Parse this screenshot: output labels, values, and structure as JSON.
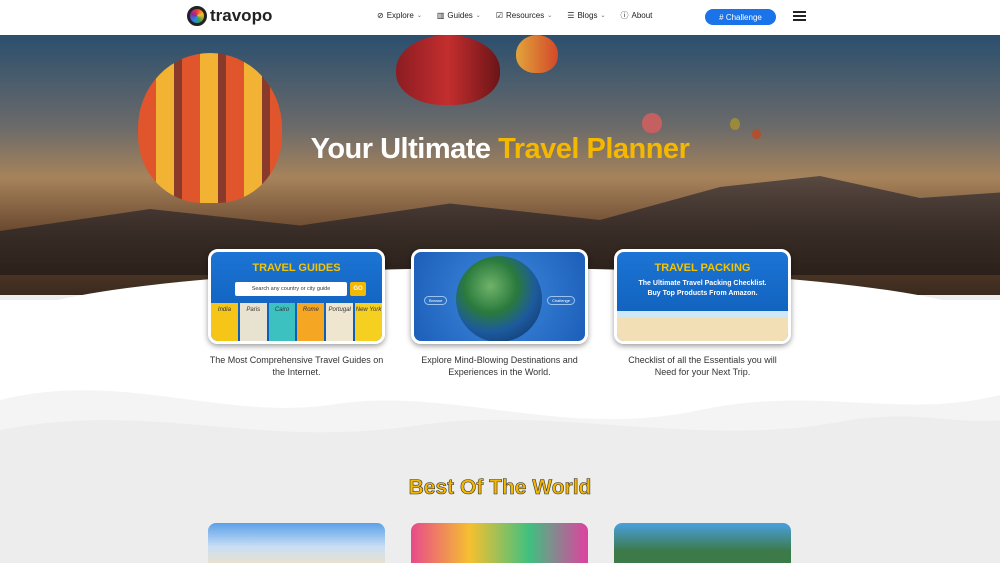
{
  "nav": {
    "brand": "travopo",
    "items": [
      {
        "label": "Explore",
        "icon": "compass-icon",
        "dropdown": true
      },
      {
        "label": "Guides",
        "icon": "map-icon",
        "dropdown": true
      },
      {
        "label": "Resources",
        "icon": "calendar-check-icon",
        "dropdown": true
      },
      {
        "label": "Blogs",
        "icon": "list-icon",
        "dropdown": true
      },
      {
        "label": "About",
        "icon": "info-icon",
        "dropdown": false
      }
    ],
    "challenge": "# Challenge",
    "accent": "#1a73e8"
  },
  "hero": {
    "title_plain": "Your Ultimate ",
    "title_accent": "Travel Planner",
    "accent": "#f5b800"
  },
  "cards": [
    {
      "title": "TRAVEL GUIDES",
      "search_placeholder": "Search any country or city guide",
      "go": "GO",
      "books": [
        "India",
        "Paris",
        "Cairo",
        "Rome",
        "Portugal",
        "New York"
      ],
      "description": "The Most Comprehensive Travel Guides on the Internet."
    },
    {
      "left_pill": "Browse",
      "right_pill": "Challenge",
      "description": "Explore Mind-Blowing Destinations and Experiences in the World."
    },
    {
      "title": "TRAVEL PACKING",
      "subtitle": "The Ultimate Travel Packing Checklist. Buy Top Products From Amazon.",
      "description": "Checklist of all the Essentials you will Need for your Next Trip."
    }
  ],
  "best": {
    "title": "Best Of The World"
  }
}
